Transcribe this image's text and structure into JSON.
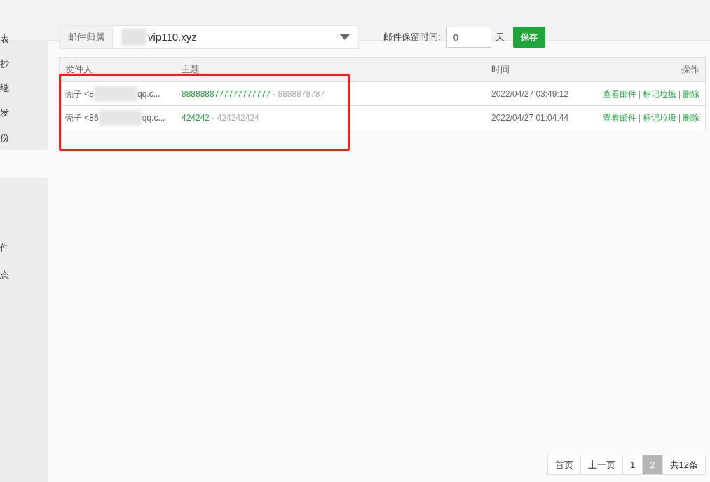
{
  "sidebar": {
    "items": [
      "表",
      "抄",
      "继",
      "发",
      "份",
      "件",
      "态"
    ]
  },
  "domain_select": {
    "label": "邮件归属",
    "value": "vip110.xyz"
  },
  "retention": {
    "label": "邮件保留时间:",
    "value": "0",
    "unit": "天",
    "save_button": "保存"
  },
  "table": {
    "columns": [
      "发件人",
      "主题",
      "时间",
      "操作"
    ],
    "rows": [
      {
        "sender_start": "壳子 <8",
        "sender_end": "qq.c...",
        "subject": "8888888777777777777",
        "preview": " - 8888878787",
        "time": "2022/04/27 03:49:12",
        "actions": [
          "查看邮件",
          "标记垃圾",
          "删除"
        ],
        "action_separator": "|"
      },
      {
        "sender_start": "壳子 <86",
        "sender_end": "qq.c...",
        "subject": "424242",
        "preview": " - 424242424",
        "time": "2022/04/27 01:04:44",
        "actions": [
          "查看邮件",
          "标记垃圾",
          "删除"
        ],
        "action_separator": "|"
      }
    ]
  },
  "pagination": [
    {
      "label": "首页",
      "selected": false
    },
    {
      "label": "上一页",
      "selected": false
    },
    {
      "label": "1",
      "selected": false
    },
    {
      "label": "2",
      "selected": true
    },
    {
      "label": "共12条",
      "selected": false
    }
  ]
}
